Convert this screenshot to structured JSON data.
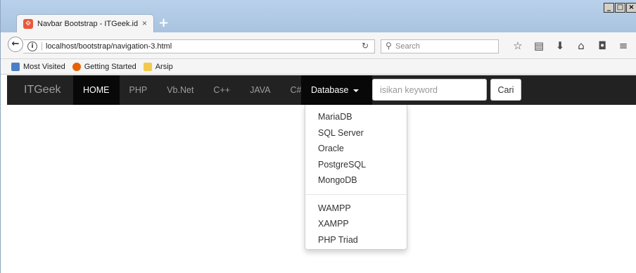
{
  "browser": {
    "tab_title": "Navbar Bootstrap - ITGeek.id",
    "tab_close": "×",
    "new_tab": "+",
    "url": "localhost/bootstrap/navigation-3.html",
    "search_placeholder": "Search",
    "window_controls": [
      "_",
      "□",
      "×"
    ],
    "bookmarks": [
      {
        "label": "Most Visited",
        "icon": "most-visited-icon",
        "color": "#4a7fc7"
      },
      {
        "label": "Getting Started",
        "icon": "firefox-icon",
        "color": "#e66000"
      },
      {
        "label": "Arsip",
        "icon": "folder-icon",
        "color": "#f2c94c"
      }
    ]
  },
  "navbar": {
    "brand": "ITGeek",
    "links": [
      "HOME",
      "PHP",
      "Vb.Net",
      "C++",
      "JAVA",
      "C#"
    ],
    "active_link": "HOME",
    "dropdown_label": "Database",
    "search_placeholder": "isikan keyword",
    "search_button": "Cari"
  },
  "dropdown": {
    "group1": [
      "MariaDB",
      "SQL Server",
      "Oracle",
      "PostgreSQL",
      "MongoDB"
    ],
    "group2": [
      "WAMPP",
      "XAMPP",
      "PHP Triad"
    ]
  },
  "colors": {
    "navbar_bg": "#222222",
    "navbar_active_bg": "#080808",
    "navbar_link": "#9d9d9d"
  }
}
